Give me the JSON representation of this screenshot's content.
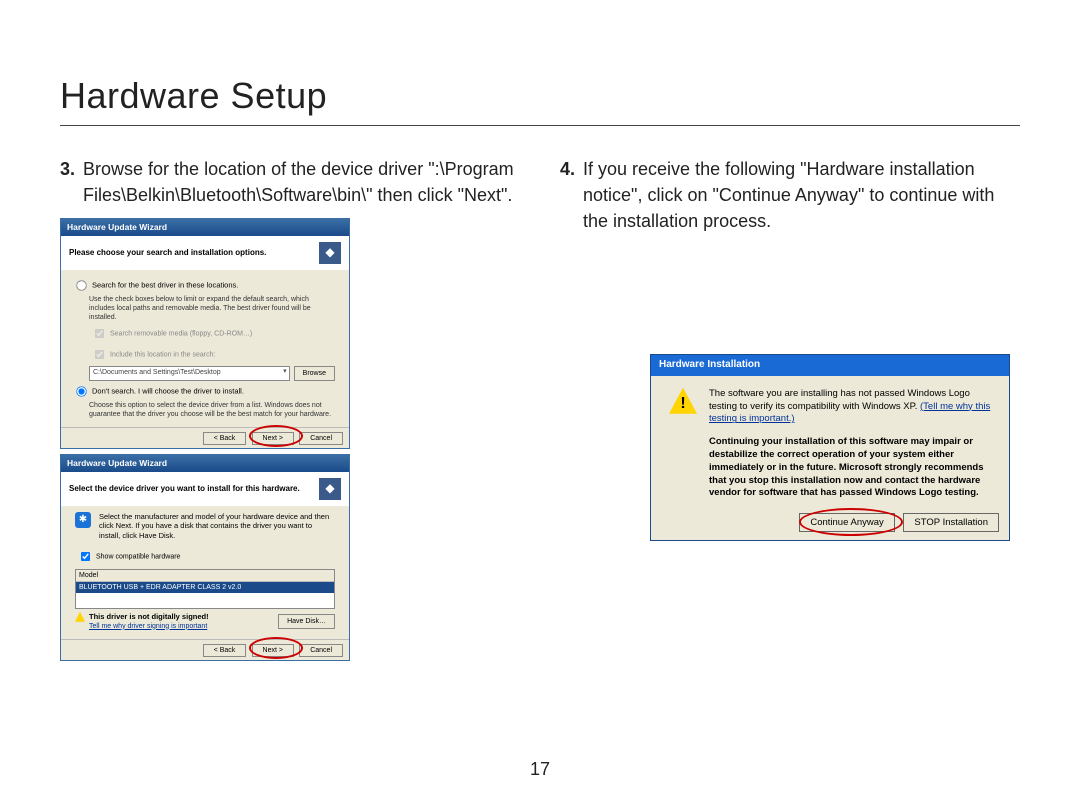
{
  "page": {
    "title": "Hardware Setup",
    "number": "17"
  },
  "steps": {
    "s3": {
      "num": "3.",
      "text": "Browse for the location of the device driver \":\\Program Files\\Belkin\\Bluetooth\\Software\\bin\\\" then click \"Next\"."
    },
    "s4": {
      "num": "4.",
      "text": "If you receive the following \"Hardware installation notice\", click on \"Continue Anyway\" to continue with the installation process."
    }
  },
  "wiz1": {
    "title": "Hardware Update Wizard",
    "heading": "Please choose your search and installation options.",
    "opt_search": "Search for the best driver in these locations.",
    "search_help": "Use the check boxes below to limit or expand the default search, which includes local paths and removable media. The best driver found will be installed.",
    "chk_removable": "Search removable media (floppy, CD-ROM…)",
    "chk_include": "Include this location in the search:",
    "path": "C:\\Documents and Settings\\Test\\Desktop",
    "browse": "Browse",
    "opt_dont": "Don't search. I will choose the driver to install.",
    "dont_help": "Choose this option to select the device driver from a list. Windows does not guarantee that the driver you choose will be the best match for your hardware.",
    "back": "< Back",
    "next": "Next >",
    "cancel": "Cancel"
  },
  "wiz2": {
    "title": "Hardware Update Wizard",
    "heading": "Select the device driver you want to install for this hardware.",
    "instr": "Select the manufacturer and model of your hardware device and then click Next. If you have a disk that contains the driver you want to install, click Have Disk.",
    "chk_compat": "Show compatible hardware",
    "col_model": "Model",
    "model_row": "BLUETOOTH USB + EDR ADAPTER CLASS 2 v2.0",
    "not_signed": "This driver is not digitally signed!",
    "why_link": "Tell me why driver signing is important",
    "have_disk": "Have Disk…",
    "back": "< Back",
    "next": "Next >",
    "cancel": "Cancel"
  },
  "hwi": {
    "title": "Hardware Installation",
    "line1a": "The software you are installing has not passed Windows Logo testing to verify its compatibility with Windows XP. ",
    "link": "(Tell me why this testing is important.)",
    "bold": "Continuing your installation of this software may impair or destabilize the correct operation of your system either immediately or in the future. Microsoft strongly recommends that you stop this installation now and contact the hardware vendor for software that has passed Windows Logo testing.",
    "continue": "Continue Anyway",
    "stop": "STOP Installation"
  }
}
